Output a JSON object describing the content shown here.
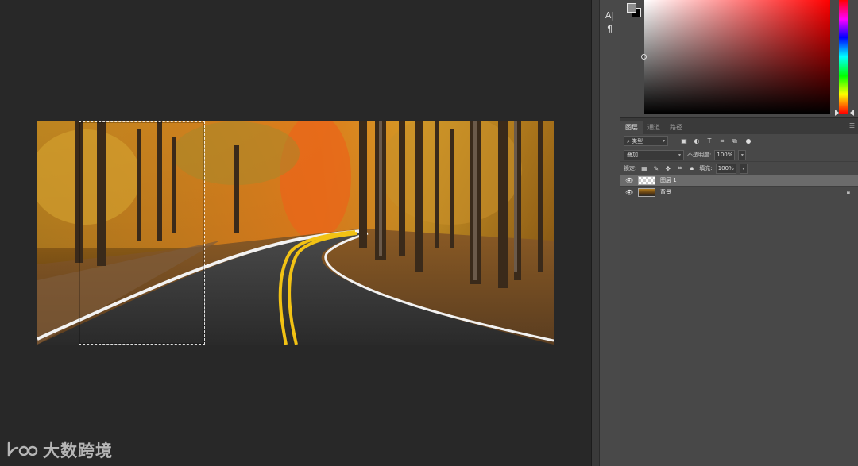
{
  "watermark": {
    "text": "大数跨境"
  },
  "mini_toolbar": {
    "tools": [
      {
        "name": "character-panel-icon",
        "glyph": "A|"
      },
      {
        "name": "paragraph-panel-icon",
        "glyph": "¶"
      }
    ]
  },
  "color_picker": {
    "foreground": "#8c8c8c",
    "background": "#000000",
    "hue": "#ff0000"
  },
  "layers_panel": {
    "tabs": [
      "图层",
      "通道",
      "路径"
    ],
    "active_tab": "图层",
    "filter_kind": "类型",
    "blend_mode": "叠加",
    "opacity_label": "不透明度:",
    "opacity_value": "100%",
    "lock_label": "锁定:",
    "fill_label": "填充:",
    "fill_value": "100%",
    "layers": [
      {
        "name": "图层 1",
        "selected": true,
        "visible": true,
        "locked": false
      },
      {
        "name": "背景",
        "selected": false,
        "visible": true,
        "locked": true
      }
    ]
  }
}
